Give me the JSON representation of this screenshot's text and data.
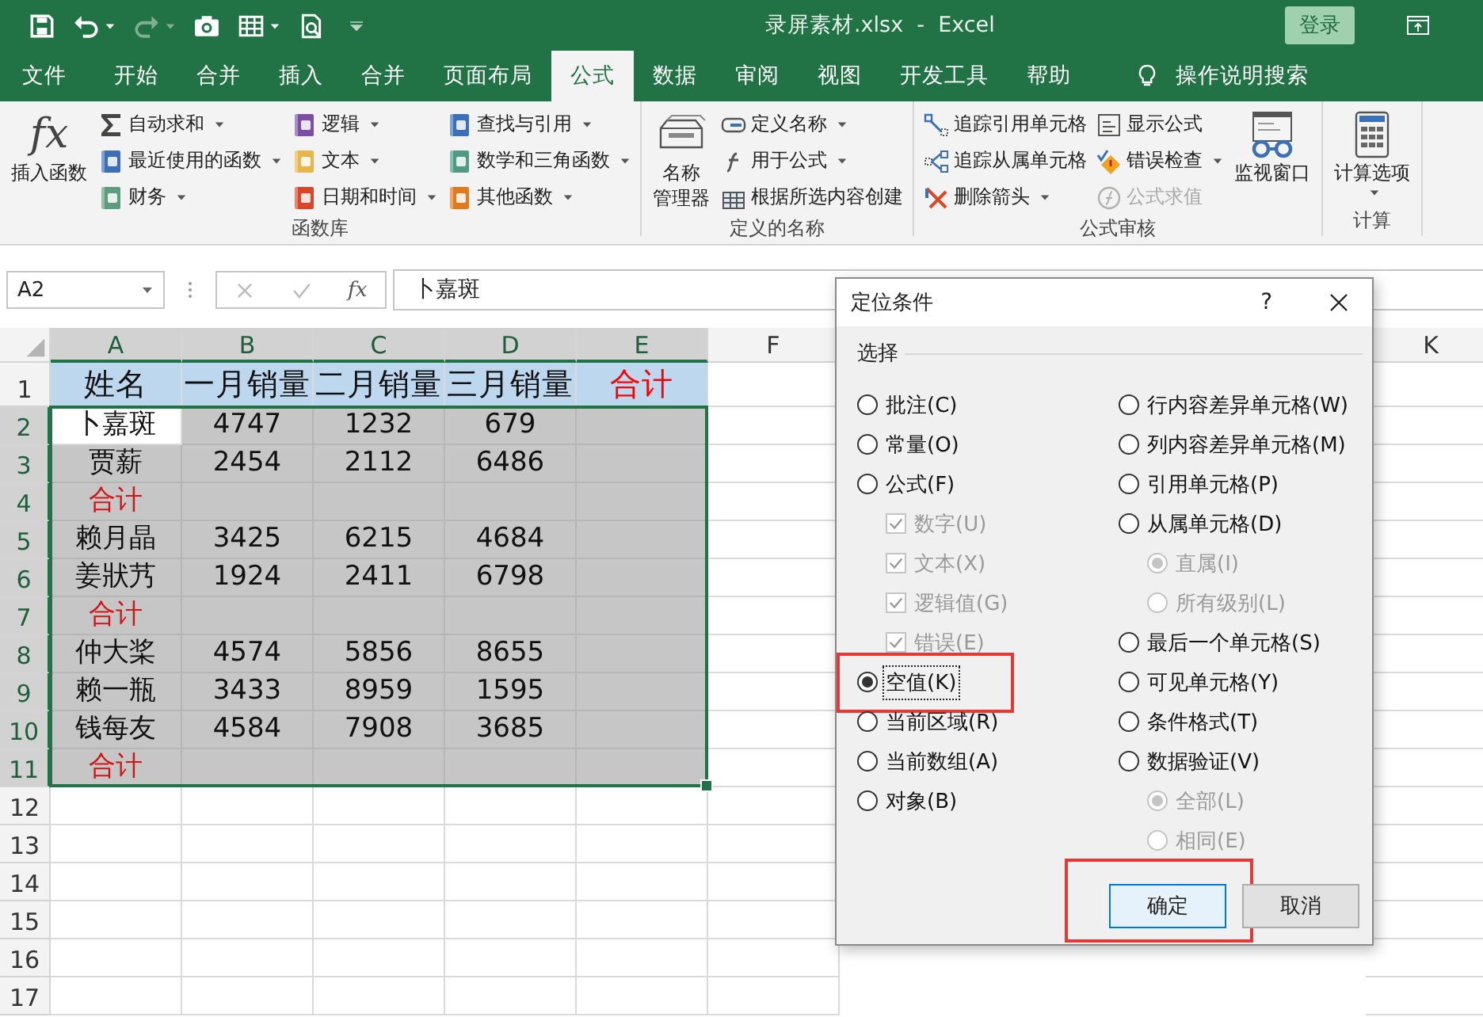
{
  "window": {
    "title": "录屏素材.xlsx  -  Excel",
    "sign_in": "登录"
  },
  "quick_access": [
    {
      "dropdown": false,
      "disabled": false
    },
    {
      "dropdown": true,
      "disabled": false
    },
    {
      "dropdown": true,
      "disabled": true
    },
    {
      "dropdown": false,
      "disabled": false
    },
    {
      "dropdown": true,
      "disabled": false
    },
    {
      "dropdown": false,
      "disabled": false
    }
  ],
  "tabs": [
    {
      "label": "文件",
      "selected": false
    },
    {
      "label": "开始",
      "selected": false
    },
    {
      "label": "合并",
      "selected": false
    },
    {
      "label": "插入",
      "selected": false
    },
    {
      "label": "合并",
      "selected": false
    },
    {
      "label": "页面布局",
      "selected": false
    },
    {
      "label": "公式",
      "selected": true
    },
    {
      "label": "数据",
      "selected": false
    },
    {
      "label": "审阅",
      "selected": false
    },
    {
      "label": "视图",
      "selected": false
    },
    {
      "label": "开发工具",
      "selected": false
    },
    {
      "label": "帮助",
      "selected": false
    }
  ],
  "search": {
    "label": "操作说明搜索"
  },
  "ribbon": [
    {
      "label": "函数库",
      "items": [
        {
          "kind": "large",
          "glyph": "fx",
          "lines": [
            "插入函数"
          ],
          "dropdown": false
        },
        {
          "kind": "column",
          "items": [
            {
              "label": "自动求和",
              "dropdown": true,
              "disabled": false
            },
            {
              "label": "最近使用的函数",
              "dropdown": true,
              "disabled": false
            },
            {
              "label": "财务",
              "dropdown": true,
              "disabled": false
            }
          ]
        },
        {
          "kind": "column",
          "items": [
            {
              "label": "逻辑",
              "dropdown": true,
              "disabled": false
            },
            {
              "label": "文本",
              "dropdown": true,
              "disabled": false
            },
            {
              "label": "日期和时间",
              "dropdown": true,
              "disabled": false
            }
          ]
        },
        {
          "kind": "column",
          "items": [
            {
              "label": "查找与引用",
              "dropdown": true,
              "disabled": false
            },
            {
              "label": "数学和三角函数",
              "dropdown": true,
              "disabled": false
            },
            {
              "label": "其他函数",
              "dropdown": true,
              "disabled": false
            }
          ]
        }
      ]
    },
    {
      "label": "定义的名称",
      "items": [
        {
          "kind": "large",
          "lines": [
            "名称",
            "管理器"
          ],
          "dropdown": false
        },
        {
          "kind": "column",
          "items": [
            {
              "label": "定义名称",
              "dropdown": true,
              "disabled": false
            },
            {
              "label": "用于公式",
              "dropdown": true,
              "disabled": false
            },
            {
              "label": "根据所选内容创建",
              "dropdown": false,
              "disabled": false
            }
          ]
        }
      ]
    },
    {
      "label": "公式审核",
      "items": [
        {
          "kind": "column",
          "items": [
            {
              "label": "追踪引用单元格",
              "dropdown": false,
              "disabled": false
            },
            {
              "label": "追踪从属单元格",
              "dropdown": false,
              "disabled": false
            },
            {
              "label": "删除箭头",
              "dropdown": true,
              "disabled": false
            }
          ]
        },
        {
          "kind": "column",
          "items": [
            {
              "label": "显示公式",
              "dropdown": false,
              "disabled": false
            },
            {
              "label": "错误检查",
              "dropdown": true,
              "disabled": false
            },
            {
              "label": "公式求值",
              "dropdown": false,
              "disabled": true
            }
          ]
        },
        {
          "kind": "large",
          "lines": [
            "监视窗口"
          ],
          "dropdown": false
        }
      ]
    },
    {
      "label": "计算",
      "items": [
        {
          "kind": "large",
          "lines": [
            "计算选项"
          ],
          "dropdown": true
        }
      ]
    }
  ],
  "formula_bar": {
    "name_box": "A2",
    "function_label": "fx",
    "value": "卜嘉斑"
  },
  "sheet": {
    "columns": [
      {
        "label": "A",
        "selected": true
      },
      {
        "label": "B",
        "selected": true
      },
      {
        "label": "C",
        "selected": true
      },
      {
        "label": "D",
        "selected": true
      },
      {
        "label": "E",
        "selected": true
      },
      {
        "label": "F",
        "selected": false
      },
      {
        "label": "K",
        "selected": false
      }
    ],
    "rows": [
      {
        "label": "1",
        "selected": false,
        "highlighted": true,
        "cells": [
          {
            "text": "姓名"
          },
          {
            "text": "一月销量"
          },
          {
            "text": "二月销量"
          },
          {
            "text": "三月销量"
          },
          {
            "text": "合计",
            "color": "#ff0000"
          }
        ]
      },
      {
        "label": "2",
        "selected": true,
        "highlighted": false,
        "cells": [
          {
            "text": "卜嘉斑",
            "active": true
          },
          {
            "text": "4747"
          },
          {
            "text": "1232"
          },
          {
            "text": "679"
          }
        ]
      },
      {
        "label": "3",
        "selected": true,
        "highlighted": false,
        "cells": [
          {
            "text": "贾薪"
          },
          {
            "text": "2454"
          },
          {
            "text": "2112"
          },
          {
            "text": "6486"
          }
        ]
      },
      {
        "label": "4",
        "selected": true,
        "highlighted": false,
        "cells": [
          {
            "text": "合计",
            "color": "#d01818"
          }
        ]
      },
      {
        "label": "5",
        "selected": true,
        "highlighted": false,
        "cells": [
          {
            "text": "赖月晶"
          },
          {
            "text": "3425"
          },
          {
            "text": "6215"
          },
          {
            "text": "4684"
          }
        ]
      },
      {
        "label": "6",
        "selected": true,
        "highlighted": false,
        "cells": [
          {
            "text": "姜狀艿"
          },
          {
            "text": "1924"
          },
          {
            "text": "2411"
          },
          {
            "text": "6798"
          }
        ]
      },
      {
        "label": "7",
        "selected": true,
        "highlighted": false,
        "cells": [
          {
            "text": "合计",
            "color": "#d01818"
          }
        ]
      },
      {
        "label": "8",
        "selected": true,
        "highlighted": false,
        "cells": [
          {
            "text": "仲大桨"
          },
          {
            "text": "4574"
          },
          {
            "text": "5856"
          },
          {
            "text": "8655"
          }
        ]
      },
      {
        "label": "9",
        "selected": true,
        "highlighted": false,
        "cells": [
          {
            "text": "赖一瓶"
          },
          {
            "text": "3433"
          },
          {
            "text": "8959"
          },
          {
            "text": "1595"
          }
        ]
      },
      {
        "label": "10",
        "selected": true,
        "highlighted": false,
        "cells": [
          {
            "text": "钱每友"
          },
          {
            "text": "4584"
          },
          {
            "text": "7908"
          },
          {
            "text": "3685"
          }
        ]
      },
      {
        "label": "11",
        "selected": true,
        "highlighted": false,
        "cells": [
          {
            "text": "合计",
            "color": "#d01818"
          }
        ]
      },
      {
        "label": "12",
        "selected": false,
        "highlighted": false
      },
      {
        "label": "13",
        "selected": false,
        "highlighted": false
      },
      {
        "label": "14",
        "selected": false,
        "highlighted": false
      },
      {
        "label": "15",
        "selected": false,
        "highlighted": false
      },
      {
        "label": "16",
        "selected": false,
        "highlighted": false
      },
      {
        "label": "17",
        "selected": false,
        "highlighted": false
      }
    ]
  },
  "dialog": {
    "title": "定位条件",
    "help": "?",
    "section": "选择",
    "columns": [
      [
        {
          "kind": "radio",
          "label": "批注(C)",
          "selected": false
        },
        {
          "kind": "radio",
          "label": "常量(O)",
          "selected": false
        },
        {
          "kind": "radio",
          "label": "公式(F)",
          "selected": false,
          "children": [
            {
              "kind": "checkbox",
              "label": "数字(U)",
              "checked": true,
              "disabled": true
            },
            {
              "kind": "checkbox",
              "label": "文本(X)",
              "checked": true,
              "disabled": true
            },
            {
              "kind": "checkbox",
              "label": "逻辑值(G)",
              "checked": true,
              "disabled": true
            },
            {
              "kind": "checkbox",
              "label": "错误(E)",
              "checked": true,
              "disabled": true
            }
          ]
        },
        {
          "kind": "radio",
          "label": "空值(K)",
          "selected": true,
          "focused": true,
          "highlighted": true
        },
        {
          "kind": "radio",
          "label": "当前区域(R)",
          "selected": false
        },
        {
          "kind": "radio",
          "label": "当前数组(A)",
          "selected": false
        },
        {
          "kind": "radio",
          "label": "对象(B)",
          "selected": false
        }
      ],
      [
        {
          "kind": "radio",
          "label": "行内容差异单元格(W)",
          "selected": false
        },
        {
          "kind": "radio",
          "label": "列内容差异单元格(M)",
          "selected": false
        },
        {
          "kind": "radio",
          "label": "引用单元格(P)",
          "selected": false
        },
        {
          "kind": "radio",
          "label": "从属单元格(D)",
          "selected": false,
          "children": [
            {
              "kind": "radio",
              "label": "直属(I)",
              "selected": true,
              "disabled": true
            },
            {
              "kind": "radio",
              "label": "所有级别(L)",
              "selected": false,
              "disabled": true
            }
          ]
        },
        {
          "kind": "radio",
          "label": "最后一个单元格(S)",
          "selected": false
        },
        {
          "kind": "radio",
          "label": "可见单元格(Y)",
          "selected": false
        },
        {
          "kind": "radio",
          "label": "条件格式(T)",
          "selected": false
        },
        {
          "kind": "radio",
          "label": "数据验证(V)",
          "selected": false,
          "children": [
            {
              "kind": "radio",
              "label": "全部(L)",
              "selected": true,
              "disabled": true
            },
            {
              "kind": "radio",
              "label": "相同(E)",
              "selected": false,
              "disabled": true
            }
          ]
        }
      ]
    ],
    "buttons": [
      {
        "label": "确定",
        "default": true,
        "highlighted": true
      },
      {
        "label": "取消",
        "default": false,
        "highlighted": false
      }
    ]
  }
}
